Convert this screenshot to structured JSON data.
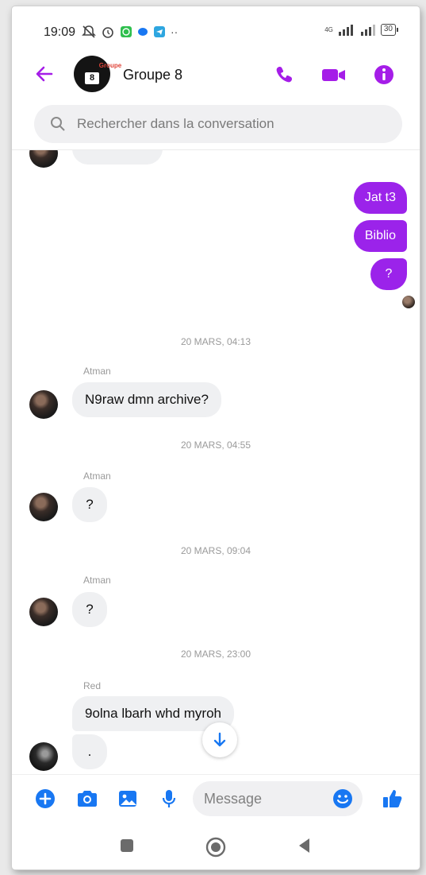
{
  "status_bar": {
    "time": "19:09",
    "network": "4G",
    "battery": "30",
    "more": "··"
  },
  "header": {
    "group_avatar_line1": "Groupe",
    "group_avatar_line2": "8",
    "group_name": "Groupe 8",
    "accent_color": "#a51de8"
  },
  "search": {
    "placeholder": "Rechercher dans la conversation"
  },
  "messages": {
    "outgoing": [
      {
        "text": "Jat t3"
      },
      {
        "text": "Biblio"
      },
      {
        "text": "?"
      }
    ],
    "groups": [
      {
        "timestamp": "20 MARS, 04:13",
        "sender": "Atman",
        "text": "N9raw dmn archive?"
      },
      {
        "timestamp": "20 MARS, 04:55",
        "sender": "Atman",
        "text": "?"
      },
      {
        "timestamp": "20 MARS, 09:04",
        "sender": "Atman",
        "text": "?"
      },
      {
        "timestamp": "20 MARS, 23:00",
        "sender": "Red",
        "text": "9olna lbarh whd myroh",
        "text2": "."
      }
    ]
  },
  "composer": {
    "placeholder": "Message"
  },
  "icons": {
    "back": "arrow-left-icon",
    "call": "phone-icon",
    "video": "video-camera-icon",
    "info": "info-icon",
    "search": "search-icon",
    "add": "plus-circle-icon",
    "camera": "camera-icon",
    "gallery": "image-icon",
    "mic": "microphone-icon",
    "emoji": "emoji-icon",
    "like": "thumbs-up-icon",
    "scroll": "arrow-down-icon"
  },
  "colors": {
    "outgoing_bubble": "#9b23ea",
    "incoming_bubble": "#eff0f2",
    "composer_blue": "#1877f2"
  }
}
